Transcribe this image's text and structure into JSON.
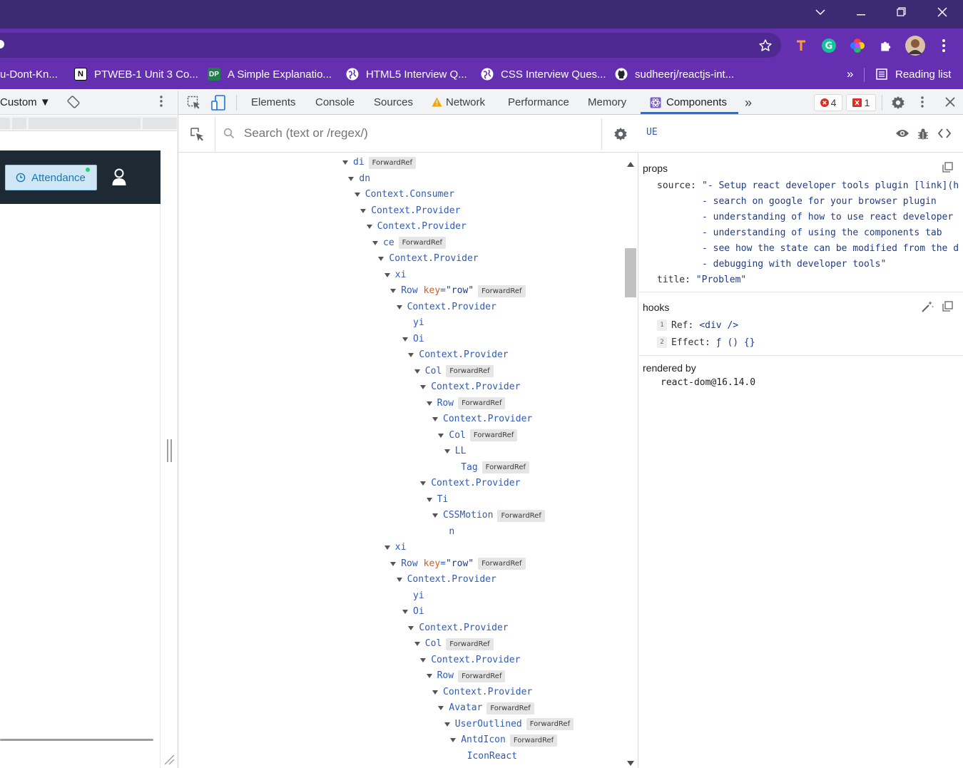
{
  "window": {
    "controls": [
      "minimize",
      "restore",
      "close"
    ]
  },
  "bookmarks": [
    {
      "label": "u-Dont-Kn...",
      "icon": "none"
    },
    {
      "label": "PTWEB-1 Unit 3 Co...",
      "icon": "notion-icon"
    },
    {
      "label": "A Simple Explanatio...",
      "icon": "dp-icon"
    },
    {
      "label": "HTML5 Interview Q...",
      "icon": "globe-icon"
    },
    {
      "label": "CSS Interview Ques...",
      "icon": "globe-icon"
    },
    {
      "label": "sudheerj/reactjs-int...",
      "icon": "github-icon"
    }
  ],
  "bookmarks_overflow": "»",
  "reading_list": "Reading list",
  "device_toolbar": {
    "device": "Custom ▼"
  },
  "app": {
    "attendance_label": "Attendance"
  },
  "devtools": {
    "tabs": [
      "Elements",
      "Console",
      "Sources",
      "Network",
      "Performance",
      "Memory",
      "Components"
    ],
    "active_tab": "Components",
    "more_tabs": "»",
    "errors_count": "4",
    "issues_count": "1"
  },
  "components": {
    "search_placeholder": "Search (text or /regex/)",
    "tree": [
      {
        "indent": 0,
        "name": "di",
        "fr": true,
        "expanded": true
      },
      {
        "indent": 1,
        "name": "dn",
        "fr": false,
        "expanded": true
      },
      {
        "indent": 2,
        "name": "Context.Consumer",
        "fr": false,
        "expanded": true
      },
      {
        "indent": 3,
        "name": "Context.Provider",
        "fr": false,
        "expanded": true
      },
      {
        "indent": 4,
        "name": "Context.Provider",
        "fr": false,
        "expanded": true
      },
      {
        "indent": 5,
        "name": "ce",
        "fr": true,
        "expanded": true
      },
      {
        "indent": 6,
        "name": "Context.Provider",
        "fr": false,
        "expanded": true
      },
      {
        "indent": 7,
        "name": "xi",
        "fr": false,
        "expanded": true
      },
      {
        "indent": 8,
        "name": "Row",
        "key": "\"row\"",
        "fr": true,
        "expanded": true
      },
      {
        "indent": 9,
        "name": "Context.Provider",
        "fr": false,
        "expanded": true
      },
      {
        "indent": 10,
        "name": "yi",
        "fr": false,
        "expanded": false
      },
      {
        "indent": 10,
        "name": "Oi",
        "fr": false,
        "expanded": true
      },
      {
        "indent": 11,
        "name": "Context.Provider",
        "fr": false,
        "expanded": true
      },
      {
        "indent": 12,
        "name": "Col",
        "fr": true,
        "expanded": true
      },
      {
        "indent": 13,
        "name": "Context.Provider",
        "fr": false,
        "expanded": true
      },
      {
        "indent": 14,
        "name": "Row",
        "fr": true,
        "expanded": true
      },
      {
        "indent": 15,
        "name": "Context.Provider",
        "fr": false,
        "expanded": true
      },
      {
        "indent": 16,
        "name": "Col",
        "fr": true,
        "expanded": true
      },
      {
        "indent": 17,
        "name": "LL",
        "fr": false,
        "expanded": true
      },
      {
        "indent": 18,
        "name": "Tag",
        "fr": true,
        "expanded": false
      },
      {
        "indent": 13,
        "name": "Context.Provider",
        "fr": false,
        "expanded": true
      },
      {
        "indent": 14,
        "name": "Ti",
        "fr": false,
        "expanded": true
      },
      {
        "indent": 15,
        "name": "CSSMotion",
        "fr": true,
        "expanded": true
      },
      {
        "indent": 16,
        "name": "n",
        "fr": false,
        "expanded": false
      },
      {
        "indent": 7,
        "name": "xi",
        "fr": false,
        "expanded": true
      },
      {
        "indent": 8,
        "name": "Row",
        "key": "\"row\"",
        "fr": true,
        "expanded": true
      },
      {
        "indent": 9,
        "name": "Context.Provider",
        "fr": false,
        "expanded": true
      },
      {
        "indent": 10,
        "name": "yi",
        "fr": false,
        "expanded": false
      },
      {
        "indent": 10,
        "name": "Oi",
        "fr": false,
        "expanded": true
      },
      {
        "indent": 11,
        "name": "Context.Provider",
        "fr": false,
        "expanded": true
      },
      {
        "indent": 12,
        "name": "Col",
        "fr": true,
        "expanded": true
      },
      {
        "indent": 13,
        "name": "Context.Provider",
        "fr": false,
        "expanded": true
      },
      {
        "indent": 14,
        "name": "Row",
        "fr": true,
        "expanded": true
      },
      {
        "indent": 15,
        "name": "Context.Provider",
        "fr": false,
        "expanded": true
      },
      {
        "indent": 16,
        "name": "Avatar",
        "fr": true,
        "expanded": true
      },
      {
        "indent": 17,
        "name": "UserOutlined",
        "fr": true,
        "expanded": true
      },
      {
        "indent": 18,
        "name": "AntdIcon",
        "fr": true,
        "expanded": true
      },
      {
        "indent": 19,
        "name": "IconReact",
        "fr": false,
        "expanded": false
      }
    ],
    "forward_ref_label": "ForwardRef",
    "key_attr": "key"
  },
  "inspector": {
    "selected": "UE",
    "props_title": "props",
    "props": {
      "source_key": "source:",
      "source_lines": [
        "\"- Setup react developer tools plugin [link](h…",
        "- search on google for your browser plugin",
        "- understanding of how to use react developer …",
        "- understanding of using the components tab",
        "- see how the state can be modified from the d…",
        "- debugging with developer tools\""
      ],
      "title_key": "title:",
      "title_value": "\"Problem\""
    },
    "hooks_title": "hooks",
    "hooks": [
      {
        "index": "1",
        "key": "Ref:",
        "value": "<div />"
      },
      {
        "index": "2",
        "key": "Effect:",
        "value": "ƒ () {}"
      }
    ],
    "rendered_by_title": "rendered by",
    "rendered_by": "react-dom@16.14.0"
  },
  "colors": {
    "titlebar": "#3c2a72",
    "toolbar": "#6430b1",
    "tree_name": "#2f5bb7",
    "key_attr": "#c8602a",
    "accent": "#1a73e8"
  }
}
